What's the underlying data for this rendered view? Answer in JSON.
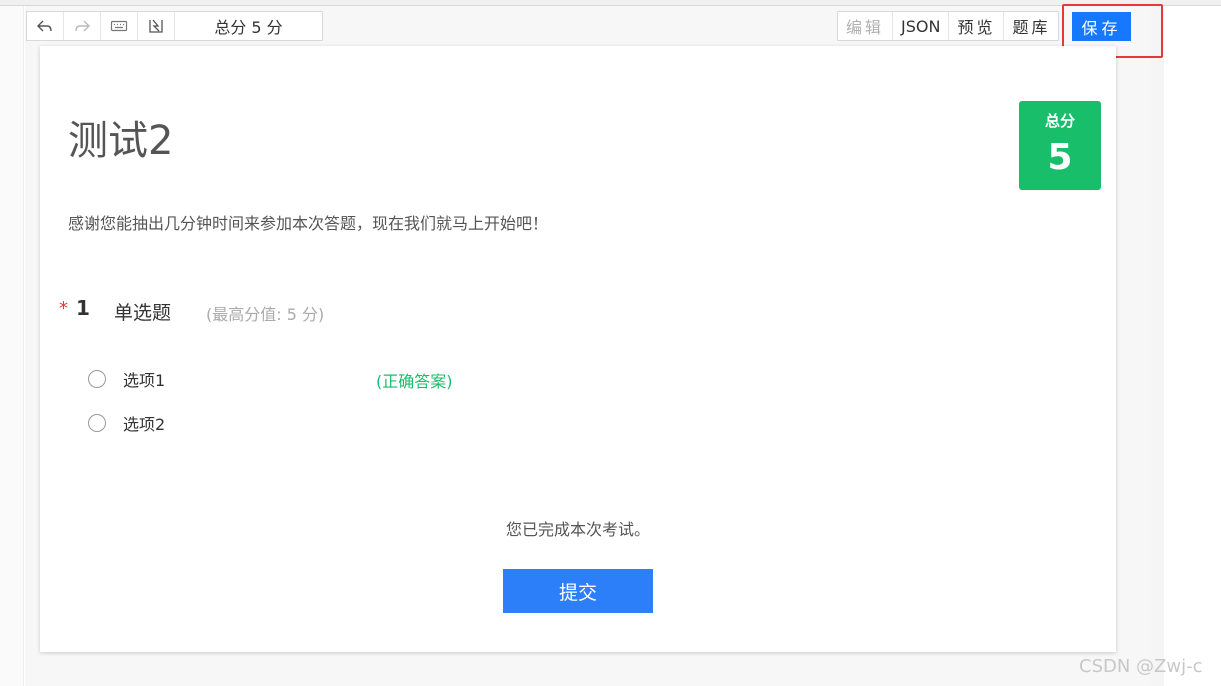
{
  "toolbar": {
    "total_score_text": "总分 5 分",
    "edit_label": "编辑",
    "json_label": "JSON",
    "preview_label": "预览",
    "bank_label": "题库",
    "save_label": "保存",
    "icons": [
      "undo-icon",
      "redo-icon",
      "keyboard-icon",
      "import-icon"
    ]
  },
  "survey": {
    "title": "测试2",
    "score_badge_label": "总分",
    "score_badge_value": "5",
    "description": "感谢您能抽出几分钟时间来参加本次答题，现在我们就马上开始吧！"
  },
  "question": {
    "required_mark": "*",
    "number": "1",
    "type_label": "单选题",
    "max_score_text": "(最高分值: 5 分)",
    "options": [
      {
        "label": "选项1",
        "correct": true
      },
      {
        "label": "选项2",
        "correct": false
      }
    ],
    "correct_tag": "(正确答案)"
  },
  "footer": {
    "completed_text": "您已完成本次考试。",
    "submit_label": "提交"
  },
  "watermark": "CSDN @Zwj-c",
  "colors": {
    "accent": "#1677ff",
    "success": "#19be6b",
    "required": "#e53935",
    "submit": "#2d7ff9"
  }
}
